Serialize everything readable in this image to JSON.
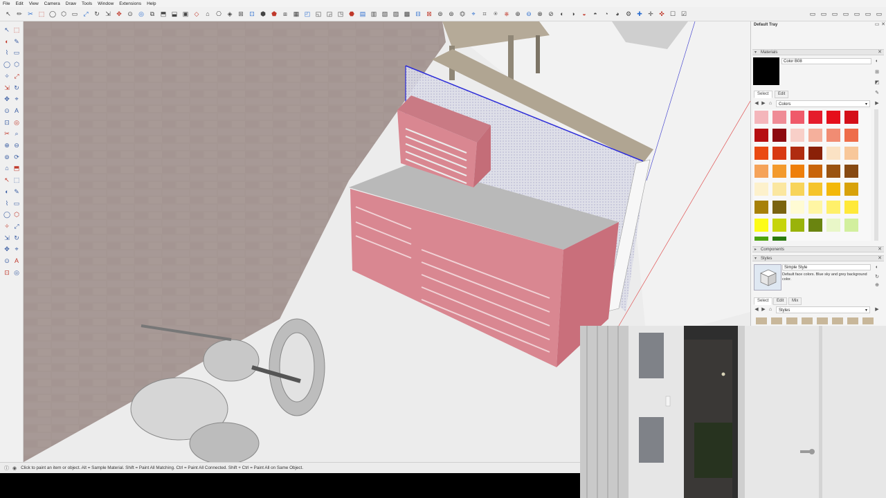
{
  "menu": [
    "File",
    "Edit",
    "View",
    "Camera",
    "Draw",
    "Tools",
    "Window",
    "Extensions",
    "Help"
  ],
  "status": {
    "hint": "Click to paint an item or object.  Alt = Sample Material.  Shift = Paint All Matching.  Ctrl = Paint All Connected.  Shift + Ctrl = Paint All on Same Object."
  },
  "tray": {
    "title": "Default Tray",
    "materials": {
      "header": "Materials",
      "material_name": "Color B08",
      "tab_select": "Select",
      "tab_edit": "Edit",
      "collection": "Colors",
      "swatch_colors": [
        "#f4b6bb",
        "#ef8c96",
        "#ef5a6a",
        "#e51c2c",
        "#e50f1b",
        "#d40f18",
        "#b60f12",
        "#8c0a10",
        "#f8cfc8",
        "#f5b09c",
        "#f18c73",
        "#ee6d4a",
        "#ea4a12",
        "#d83912",
        "#b02c10",
        "#8a2108",
        "#fbe2c4",
        "#f8c79a",
        "#f5a35a",
        "#f39a2c",
        "#ee7f0a",
        "#c8650a",
        "#9a5310",
        "#874a12",
        "#fdf1cc",
        "#fbe7a0",
        "#f8d45a",
        "#f5c42c",
        "#f3b80a",
        "#d8a20a",
        "#a78108",
        "#7a6310",
        "#fffbd4",
        "#fff6a4",
        "#fff06a",
        "#ffe93a",
        "#fdfc17",
        "#c6d40c",
        "#9ab30a",
        "#6a8410",
        "#e9f7c8",
        "#d2ef9e",
        "#4ea40f",
        "#2a7a0f"
      ]
    },
    "components": {
      "header": "Components"
    },
    "styles": {
      "header": "Styles",
      "style_name": "Simple Style",
      "style_desc": "Default face colors. Blue sky and grey background color.",
      "tab_select": "Select",
      "tab_edit": "Edit",
      "tab_mix": "Mix",
      "collection": "Styles"
    }
  },
  "colors": {
    "accent_blue": "#2b2bd8",
    "cabinet_red": "#d98791",
    "brick": "#8f7a76",
    "selected_material": "#000000"
  }
}
